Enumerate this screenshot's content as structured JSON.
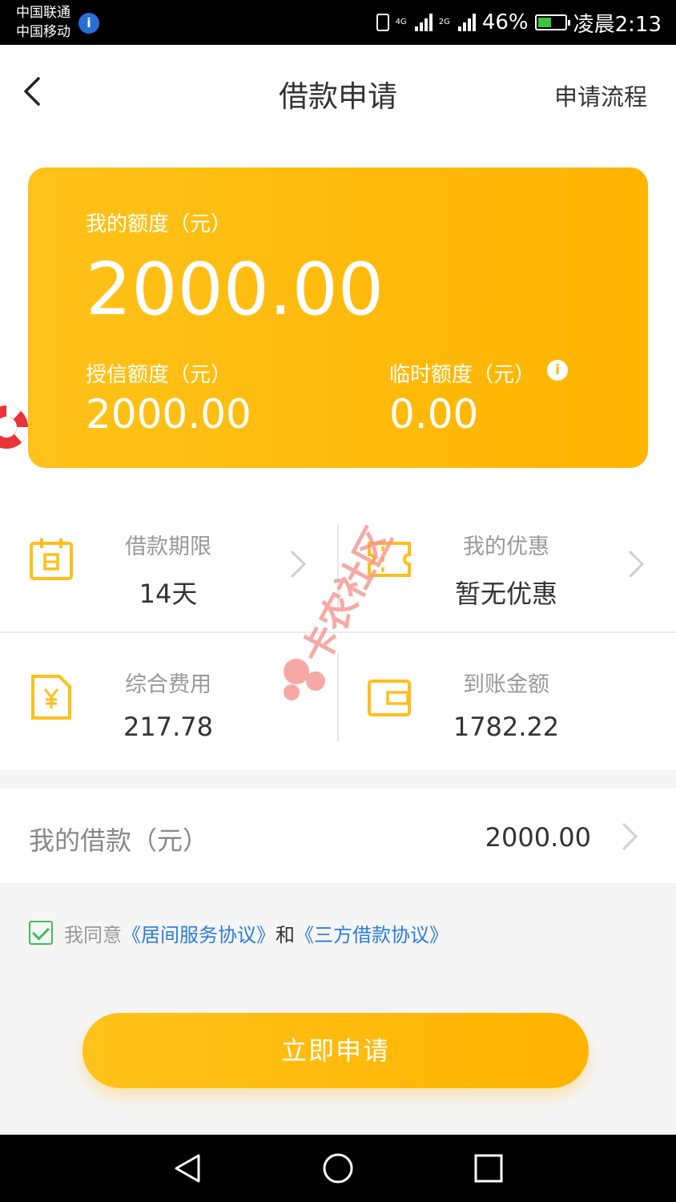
{
  "status_bar": {
    "carrier1": "中国联通",
    "carrier2": "中国移动",
    "net1": "4G",
    "net2": "2G",
    "battery": "46%",
    "time": "凌晨2:13"
  },
  "header": {
    "title": "借款申请",
    "process_link": "申请流程"
  },
  "credit_card": {
    "my_limit_label": "我的额度（元）",
    "my_limit_value": "2000.00",
    "granted_label": "授信额度（元）",
    "granted_value": "2000.00",
    "temp_label": "临时额度（元）",
    "temp_value": "0.00"
  },
  "details": {
    "term_label": "借款期限",
    "term_value": "14天",
    "coupon_label": "我的优惠",
    "coupon_value": "暂无优惠",
    "fee_label": "综合费用",
    "fee_value": "217.78",
    "arrival_label": "到账金额",
    "arrival_value": "1782.22"
  },
  "watermark": "卡农社区",
  "loan": {
    "label": "我的借款（元）",
    "value": "2000.00"
  },
  "agreement": {
    "prefix": "我同意",
    "link1": "《居间服务协议》",
    "and": "和",
    "link2": "《三方借款协议》"
  },
  "apply_button": "立即申请",
  "colors": {
    "accent": "#FFB400",
    "link": "#2A7DE1",
    "check": "#3CBF5C"
  }
}
